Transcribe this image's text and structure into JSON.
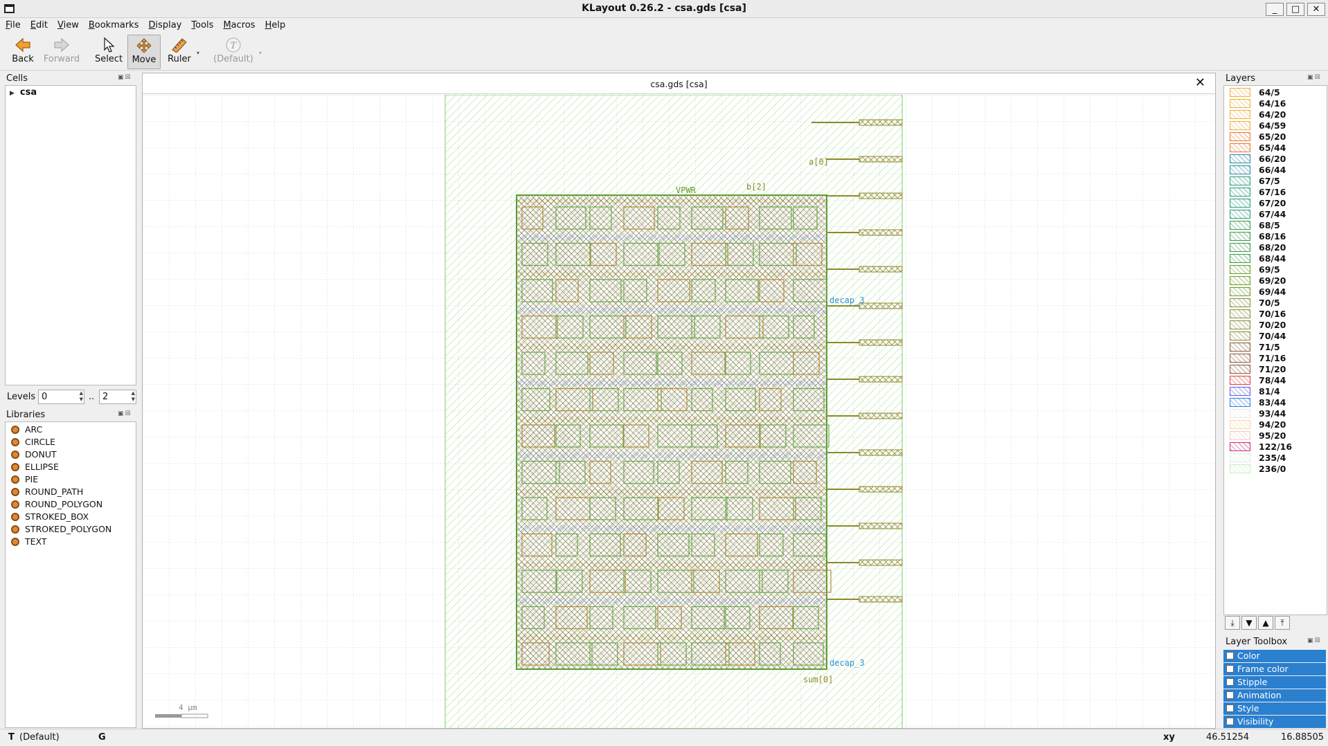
{
  "window": {
    "title": "KLayout 0.26.2 - csa.gds [csa]",
    "controls": [
      "_",
      "□",
      "✕"
    ]
  },
  "menu": [
    "File",
    "Edit",
    "View",
    "Bookmarks",
    "Display",
    "Tools",
    "Macros",
    "Help"
  ],
  "toolbar": {
    "back": "Back",
    "forward": "Forward",
    "select": "Select",
    "move": "Move",
    "ruler": "Ruler",
    "text_default": "(Default)"
  },
  "cells": {
    "title": "Cells",
    "root": "csa"
  },
  "levels": {
    "label": "Levels",
    "from": "0",
    "sep": "..",
    "to": "2"
  },
  "libraries": {
    "title": "Libraries",
    "items": [
      "ARC",
      "CIRCLE",
      "DONUT",
      "ELLIPSE",
      "PIE",
      "ROUND_PATH",
      "ROUND_POLYGON",
      "STROKED_BOX",
      "STROKED_POLYGON",
      "TEXT"
    ]
  },
  "view": {
    "tab_title": "csa.gds [csa]",
    "scale_label": "4 µm",
    "labels": [
      "VPWR",
      "a[0]",
      "b[2]",
      "decap_3",
      "decap_3",
      "sum[0]"
    ]
  },
  "layers": {
    "title": "Layers",
    "items": [
      {
        "name": "64/5",
        "color": "#f0b040"
      },
      {
        "name": "64/16",
        "color": "#f0b040"
      },
      {
        "name": "64/20",
        "color": "#f0b040"
      },
      {
        "name": "64/59",
        "color": "#f0b040"
      },
      {
        "name": "65/20",
        "color": "#e8783c"
      },
      {
        "name": "65/44",
        "color": "#e8783c"
      },
      {
        "name": "66/20",
        "color": "#2a8aa0"
      },
      {
        "name": "66/44",
        "color": "#2a8aa0"
      },
      {
        "name": "67/5",
        "color": "#2a9a80"
      },
      {
        "name": "67/16",
        "color": "#2a9a80"
      },
      {
        "name": "67/20",
        "color": "#2a9a80"
      },
      {
        "name": "67/44",
        "color": "#2a9a80"
      },
      {
        "name": "68/5",
        "color": "#3a9a4a"
      },
      {
        "name": "68/16",
        "color": "#3a9a4a"
      },
      {
        "name": "68/20",
        "color": "#3a9a4a"
      },
      {
        "name": "68/44",
        "color": "#3a9a4a"
      },
      {
        "name": "69/5",
        "color": "#6a9a2a"
      },
      {
        "name": "69/20",
        "color": "#6a9a2a"
      },
      {
        "name": "69/44",
        "color": "#6a9a2a"
      },
      {
        "name": "70/5",
        "color": "#8a8a3a"
      },
      {
        "name": "70/16",
        "color": "#8a8a3a"
      },
      {
        "name": "70/20",
        "color": "#8a8a3a"
      },
      {
        "name": "70/44",
        "color": "#8a8a3a"
      },
      {
        "name": "71/5",
        "color": "#8a5a3a"
      },
      {
        "name": "71/16",
        "color": "#8a5a3a"
      },
      {
        "name": "71/20",
        "color": "#8a5a3a"
      },
      {
        "name": "78/44",
        "color": "#e04040"
      },
      {
        "name": "81/4",
        "color": "#6060e0"
      },
      {
        "name": "83/44",
        "color": "#3080e0"
      },
      {
        "name": "93/44",
        "color": "#e8e8e8"
      },
      {
        "name": "94/20",
        "color": "#f8d8a0"
      },
      {
        "name": "95/20",
        "color": "#f8c8c8"
      },
      {
        "name": "122/16",
        "color": "#c03080"
      },
      {
        "name": "235/4",
        "color": "#d8f0d8"
      },
      {
        "name": "236/0",
        "color": "#c8f0b8"
      }
    ]
  },
  "layer_toolbox": {
    "title": "Layer Toolbox",
    "items": [
      "Color",
      "Frame color",
      "Stipple",
      "Animation",
      "Style",
      "Visibility"
    ]
  },
  "status": {
    "mode": "T",
    "default": "(Default)",
    "grid": "G",
    "xy_label": "xy",
    "x": "46.51254",
    "y": "16.88505"
  }
}
